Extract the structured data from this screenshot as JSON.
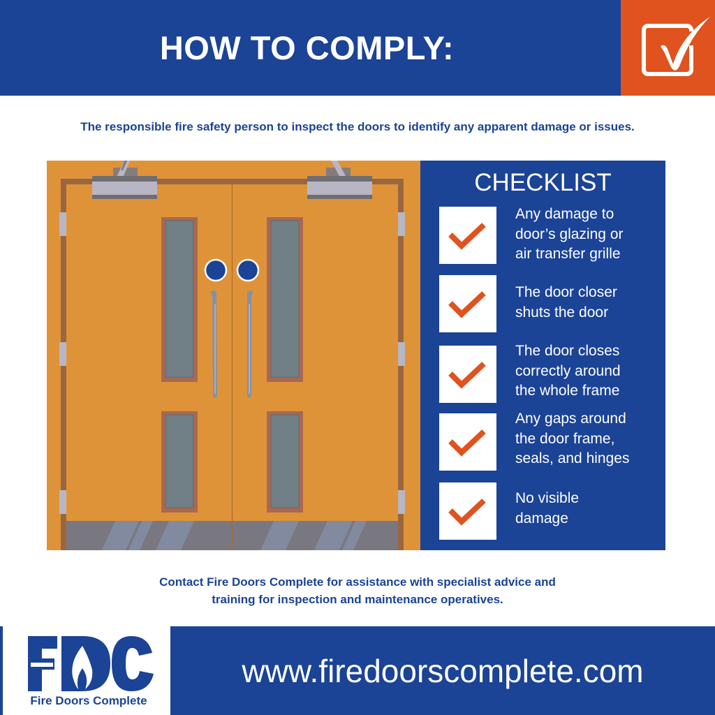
{
  "header": {
    "title": "HOW TO COMPLY:",
    "badge_icon": "checkbox-check-icon"
  },
  "subtitle": "The responsible fire safety person to inspect the doors to identify any apparent damage or issues.",
  "illustration": {
    "subject": "double fire doors with closers, vision panels, push bars and kick plates",
    "icons": [
      "door-closer-icon",
      "vision-panel-icon",
      "push-handle-icon",
      "kick-plate-icon",
      "hinge-icon"
    ]
  },
  "checklist": {
    "title": "CHECKLIST",
    "items": [
      {
        "icon": "check-icon",
        "label": "Any damage to door’s glazing or air transfer grille",
        "lines": [
          "Any damage to",
          "door’s glazing or",
          "air transfer grille"
        ]
      },
      {
        "icon": "check-icon",
        "label": "The door closer shuts the door",
        "lines": [
          "The door closer",
          "shuts the door"
        ]
      },
      {
        "icon": "check-icon",
        "label": "The door closes correctly around the whole frame",
        "lines": [
          "The door closes",
          "correctly around",
          "the whole frame"
        ]
      },
      {
        "icon": "check-icon",
        "label": "Any gaps around the door frame, seals, and hinges",
        "lines": [
          "Any gaps around",
          "the door frame,",
          "seals, and hinges"
        ]
      },
      {
        "icon": "check-icon",
        "label": "No visible damage",
        "lines": [
          "No visible",
          "damage"
        ]
      }
    ]
  },
  "contact": {
    "line1": "Contact Fire Doors Complete for assistance with specialist advice and",
    "line2": "training for inspection and maintenance operatives."
  },
  "footer": {
    "logo_letters": "FDC",
    "logo_tagline": "Fire Doors Complete",
    "website": "www.firedoorscomplete.com"
  },
  "colors": {
    "brand_blue": "#1b4396",
    "accent_orange": "#e0521e",
    "door_orange": "#df9338",
    "frame_brown": "#9a663f",
    "glass_grey": "#717f87"
  }
}
